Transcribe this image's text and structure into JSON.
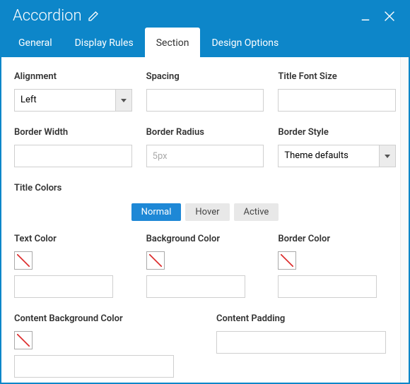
{
  "title": "Accordion",
  "tabs": [
    "General",
    "Display Rules",
    "Section",
    "Design Options"
  ],
  "active_tab": 2,
  "fields": {
    "alignment": {
      "label": "Alignment",
      "value": "Left"
    },
    "spacing": {
      "label": "Spacing",
      "value": ""
    },
    "title_font_size": {
      "label": "Title Font Size",
      "value": ""
    },
    "border_width": {
      "label": "Border Width",
      "value": ""
    },
    "border_radius": {
      "label": "Border Radius",
      "value": "",
      "placeholder": "5px"
    },
    "border_style": {
      "label": "Border Style",
      "value": "Theme defaults"
    }
  },
  "title_colors_section": "Title Colors",
  "state_tabs": [
    "Normal",
    "Hover",
    "Active"
  ],
  "active_state_tab": 0,
  "color_fields": {
    "text_color": {
      "label": "Text Color",
      "value": ""
    },
    "background_color": {
      "label": "Background Color",
      "value": ""
    },
    "border_color": {
      "label": "Border Color",
      "value": ""
    }
  },
  "content_fields": {
    "content_bg": {
      "label": "Content Background Color",
      "value": ""
    },
    "content_padding": {
      "label": "Content Padding",
      "value": ""
    }
  }
}
